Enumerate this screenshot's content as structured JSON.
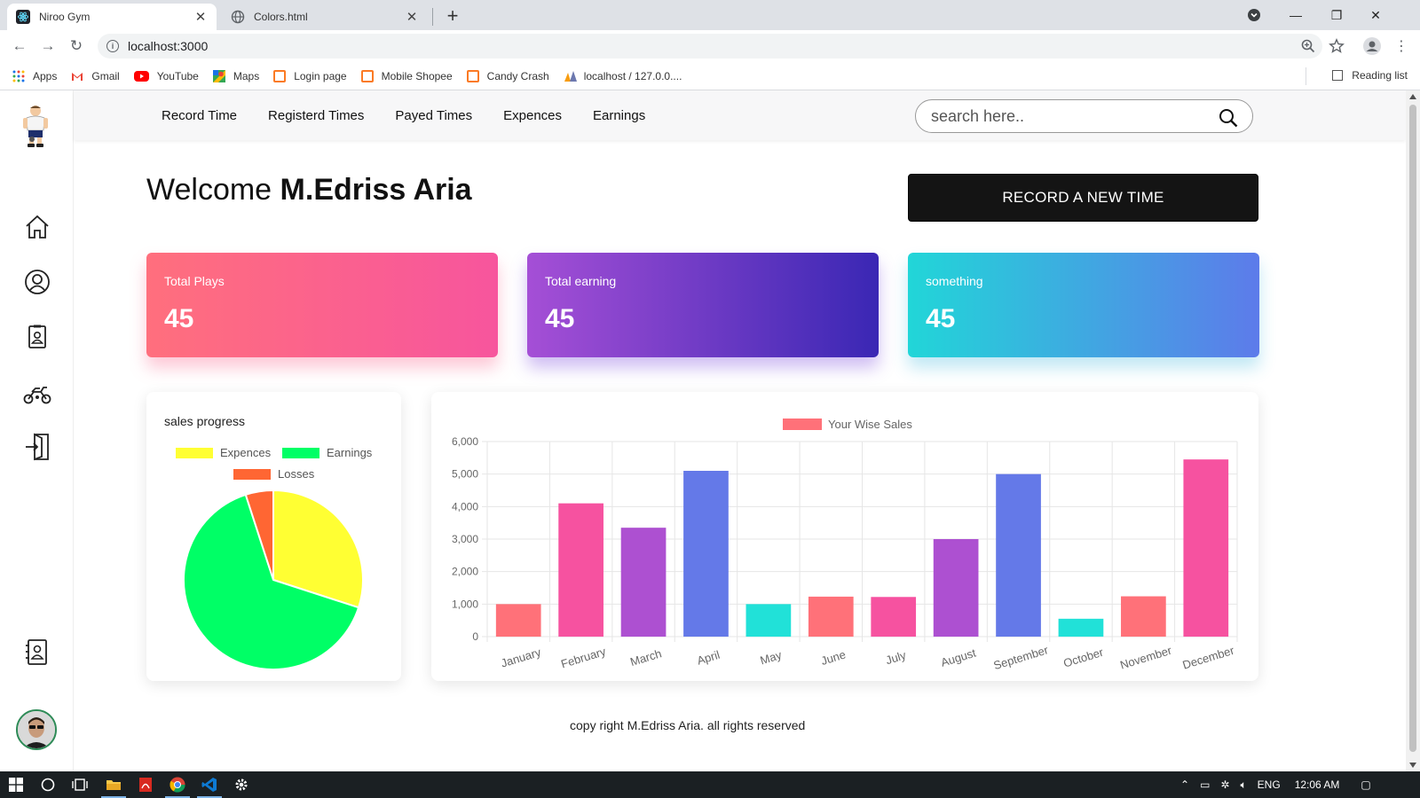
{
  "browser": {
    "tabs": [
      {
        "title": "Niroo Gym",
        "active": true
      },
      {
        "title": "Colors.html",
        "active": false
      }
    ],
    "url": "localhost:3000",
    "bookmarks": [
      "Apps",
      "Gmail",
      "YouTube",
      "Maps",
      "Login page",
      "Mobile Shopee",
      "Candy Crash",
      "localhost / 127.0.0...."
    ],
    "reading_list": "Reading list"
  },
  "nav": {
    "links": [
      "Record Time",
      "Registerd Times",
      "Payed Times",
      "Expences",
      "Earnings"
    ],
    "search_placeholder": "search here.."
  },
  "welcome": {
    "prefix": "Welcome",
    "name": "M.Edriss Aria"
  },
  "record_button": "RECORD A NEW TIME",
  "cards": [
    {
      "label": "Total Plays",
      "value": "45"
    },
    {
      "label": "Total earning",
      "value": "45"
    },
    {
      "label": "something",
      "value": "45"
    }
  ],
  "footer": "copy right M.Edriss Aria. all rights reserved",
  "taskbar": {
    "language": "ENG",
    "time": "12:06 AM"
  },
  "colors": {
    "pie_expences": "#ffff33",
    "pie_earnings": "#00ff66",
    "pie_losses": "#ff6633"
  },
  "chart_data": [
    {
      "type": "pie",
      "title": "sales progress",
      "labels": [
        "Expences",
        "Earnings",
        "Losses"
      ],
      "values": [
        30,
        65,
        5
      ],
      "colors": [
        "#ffff33",
        "#00ff66",
        "#ff6633"
      ]
    },
    {
      "type": "bar",
      "legend": "Your Wise Sales",
      "legend_color": "#ff7179",
      "categories": [
        "January",
        "February",
        "March",
        "April",
        "May",
        "June",
        "July",
        "August",
        "September",
        "October",
        "November",
        "December"
      ],
      "values": [
        1000,
        4100,
        3350,
        5100,
        1000,
        1230,
        1220,
        3000,
        5000,
        550,
        1240,
        5450
      ],
      "colors": [
        "#ff7179",
        "#f652a0",
        "#ad50d1",
        "#6479e8",
        "#21e1d8",
        "#ff7179",
        "#f652a0",
        "#ad50d1",
        "#6479e8",
        "#21e1d8",
        "#ff7179",
        "#f652a0"
      ],
      "ylim": [
        0,
        6000
      ],
      "yticks": [
        "0",
        "1,000",
        "2,000",
        "3,000",
        "4,000",
        "5,000",
        "6,000"
      ],
      "grid": true
    }
  ]
}
